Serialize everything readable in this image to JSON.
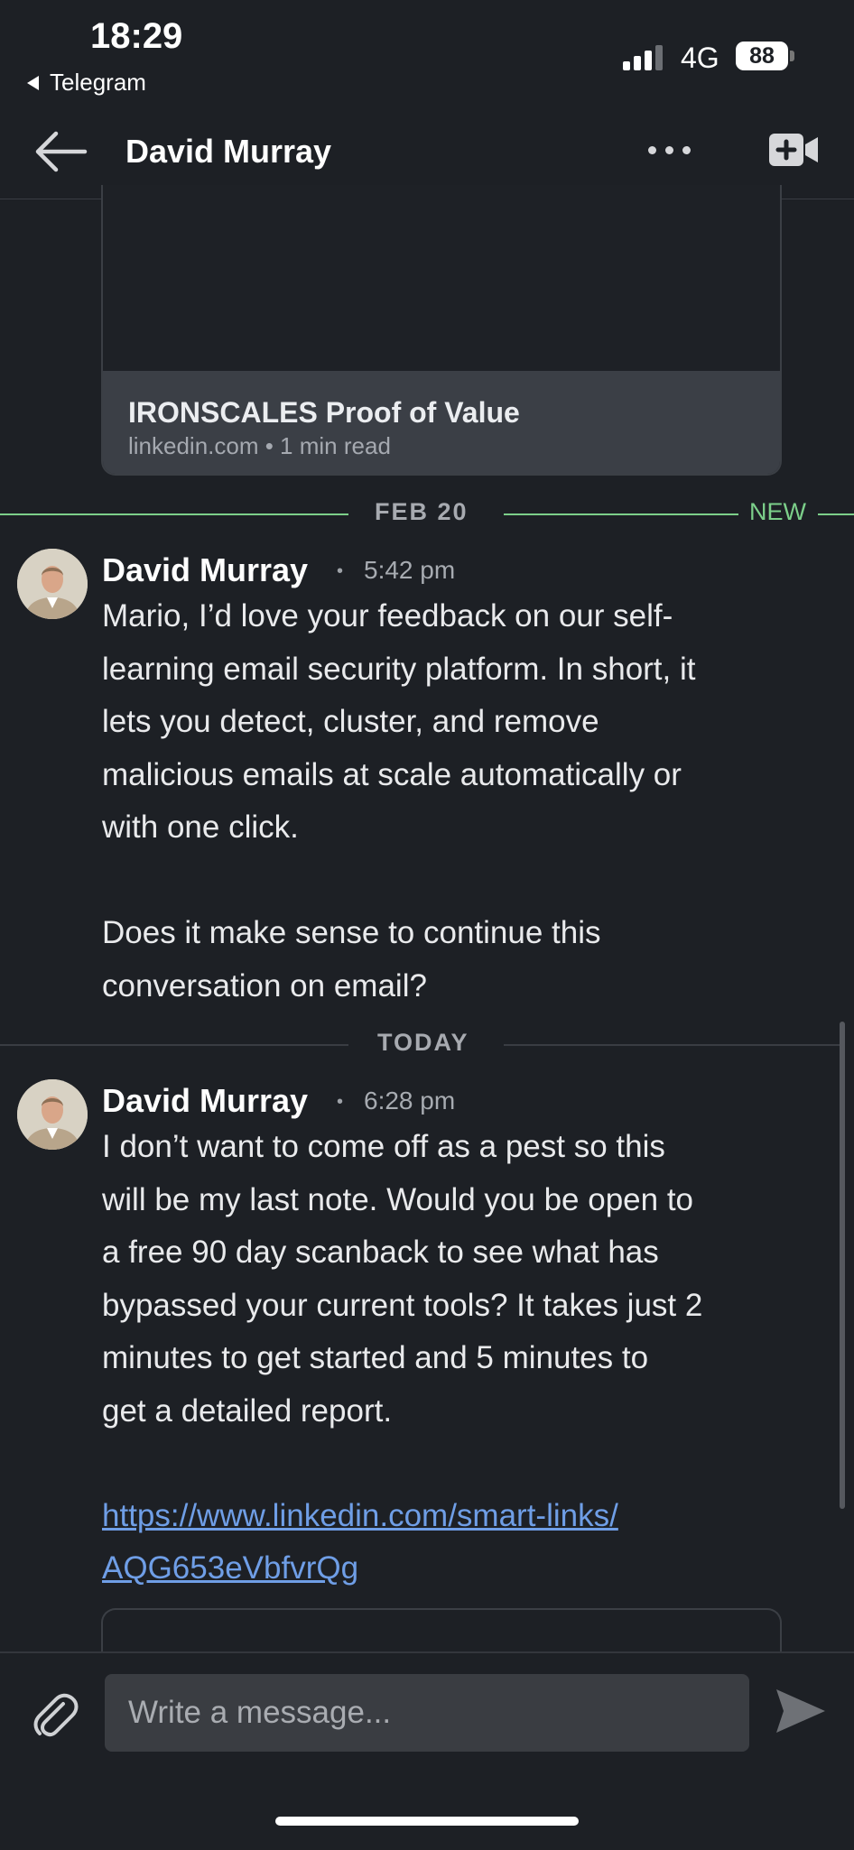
{
  "status_bar": {
    "time": "18:29",
    "back_app": "Telegram",
    "network": "4G",
    "battery": "88"
  },
  "header": {
    "contact_name": "David Murray"
  },
  "link_preview_top": {
    "title": "IRONSCALES Proof of Value",
    "source": "linkedin.com • 1 min read"
  },
  "dividers": {
    "feb20": "FEB 20",
    "new": "NEW",
    "today": "TODAY"
  },
  "messages": [
    {
      "sender": "David Murray",
      "dot": "•",
      "time": "5:42 pm",
      "text": "Mario, I’d love your feedback on our self-\nlearning email security platform. In short, it\nlets you detect, cluster, and remove\nmalicious emails at scale automatically or\nwith one click.\n\nDoes it make sense to continue this\nconversation on email?"
    },
    {
      "sender": "David Murray",
      "dot": "•",
      "time": "6:28 pm",
      "text": "I don’t want to come off as a pest so this\nwill be my last note. Would you be open to\na free 90 day scanback to see what has\nbypassed your current tools? It takes just 2\nminutes to get started and 5 minutes to\nget a detailed report.",
      "link_line1": "https://www.linkedin.com/smart-links/",
      "link_line2": "AQG653eVbfvrQg"
    }
  ],
  "composer": {
    "placeholder": "Write a message..."
  },
  "colors": {
    "background": "#1d2025",
    "new_divider": "#7ccf8a",
    "link": "#6f9ee6"
  }
}
